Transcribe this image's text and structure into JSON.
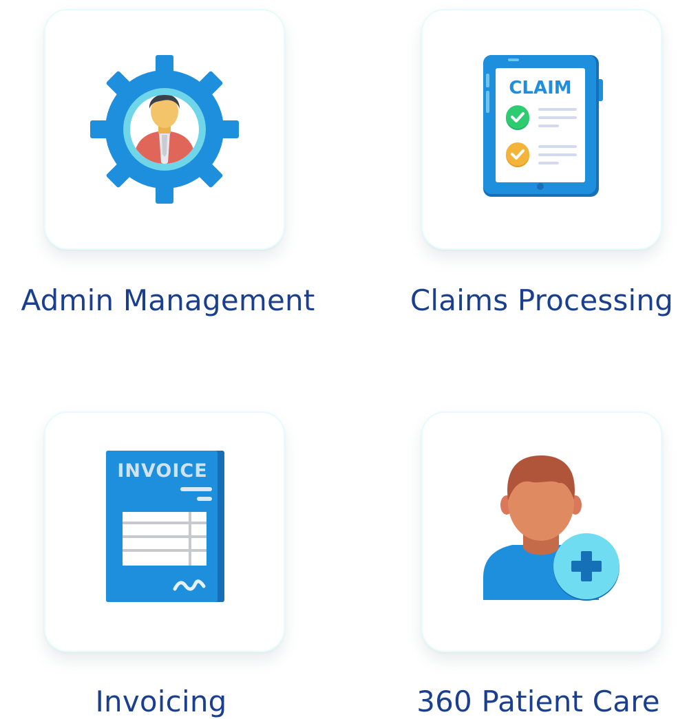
{
  "features": [
    {
      "key": "admin",
      "label": "Admin Management",
      "icon": "admin-gear-icon"
    },
    {
      "key": "claims",
      "label": "Claims Processing",
      "icon": "claim-tablet-icon",
      "icon_text": "CLAIM"
    },
    {
      "key": "invoice",
      "label": "Invoicing",
      "icon": "invoice-document-icon",
      "icon_text": "INVOICE"
    },
    {
      "key": "patient",
      "label": "360 Patient Care",
      "icon": "patient-plus-icon"
    }
  ],
  "colors": {
    "label": "#1b3f8f",
    "primary_blue": "#1d8fdc",
    "dark_blue": "#1670b8",
    "light_cyan": "#6fdcf2",
    "check_green": "#2ecc71",
    "check_yellow": "#f4b43a"
  }
}
